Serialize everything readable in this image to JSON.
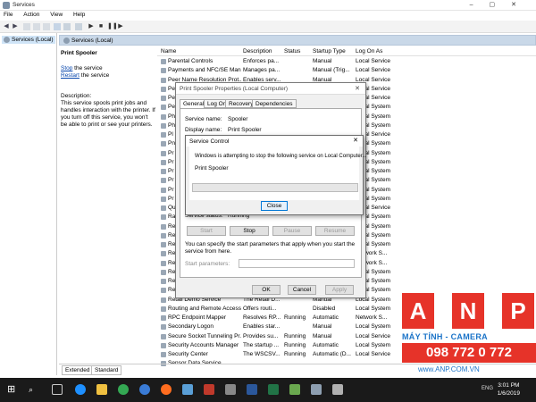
{
  "window": {
    "title": "Services"
  },
  "menu": [
    "File",
    "Action",
    "View",
    "Help"
  ],
  "tree": {
    "root": "Services (Local)"
  },
  "header": {
    "title": "Services (Local)"
  },
  "detail": {
    "service_name": "Print Spooler",
    "stop_link": "Stop",
    "stop_rest": " the service",
    "restart_link": "Restart",
    "restart_rest": " the service",
    "desc_label": "Description:",
    "desc_text": "This service spools print jobs and handles interaction with the printer. If you turn off this service, you won't be able to print or see your printers."
  },
  "columns": {
    "name": "Name",
    "description": "Description",
    "status": "Status",
    "startup": "Startup Type",
    "logon": "Log On As"
  },
  "rows": [
    {
      "name": "Parental Controls",
      "description": "Enforces pa...",
      "status": "",
      "startup": "Manual",
      "logon": "Local Service"
    },
    {
      "name": "Payments and NFC/SE Mana...",
      "description": "Manages pa...",
      "status": "",
      "startup": "Manual (Trig...",
      "logon": "Local Service"
    },
    {
      "name": "Peer Name Resolution Prot...",
      "description": "Enables serv...",
      "status": "",
      "startup": "Manual",
      "logon": "Local Service"
    },
    {
      "name": "Pe",
      "description": "",
      "status": "",
      "startup": "",
      "logon": "Local Service"
    },
    {
      "name": "Pe",
      "description": "",
      "status": "",
      "startup": "",
      "logon": "Local Service"
    },
    {
      "name": "Pe",
      "description": "",
      "status": "",
      "startup": "",
      "logon": "Local System"
    },
    {
      "name": "Ph",
      "description": "",
      "status": "",
      "startup": "",
      "logon": "Local System"
    },
    {
      "name": "Ph",
      "description": "",
      "status": "",
      "startup": "",
      "logon": "Local System"
    },
    {
      "name": "Pl",
      "description": "",
      "status": "",
      "startup": "",
      "logon": "Local Service"
    },
    {
      "name": "Pn",
      "description": "",
      "status": "",
      "startup": "",
      "logon": "Local System"
    },
    {
      "name": "Pr",
      "description": "",
      "status": "",
      "startup": "",
      "logon": "Local System"
    },
    {
      "name": "Pr",
      "description": "",
      "status": "",
      "startup": "",
      "logon": "Local System"
    },
    {
      "name": "Pr",
      "description": "",
      "status": "",
      "startup": "",
      "logon": "Local System"
    },
    {
      "name": "Pr",
      "description": "",
      "status": "",
      "startup": "",
      "logon": "Local System"
    },
    {
      "name": "Pr",
      "description": "",
      "status": "",
      "startup": "",
      "logon": "Local System"
    },
    {
      "name": "Pr",
      "description": "",
      "status": "",
      "startup": "",
      "logon": "Local System"
    },
    {
      "name": "Qu",
      "description": "",
      "status": "",
      "startup": "",
      "logon": "Local Service"
    },
    {
      "name": "Ra",
      "description": "",
      "status": "",
      "startup": "",
      "logon": "Local System"
    },
    {
      "name": "Re",
      "description": "",
      "status": "",
      "startup": "",
      "logon": "Local System"
    },
    {
      "name": "Re",
      "description": "",
      "status": "",
      "startup": "",
      "logon": "Local System"
    },
    {
      "name": "Re",
      "description": "",
      "status": "",
      "startup": "",
      "logon": "Local System"
    },
    {
      "name": "Re",
      "description": "",
      "status": "",
      "startup": "",
      "logon": "Network S..."
    },
    {
      "name": "Re",
      "description": "",
      "status": "",
      "startup": "",
      "logon": "Network S..."
    },
    {
      "name": "Re",
      "description": "",
      "status": "",
      "startup": "",
      "logon": "Local System"
    },
    {
      "name": "Re",
      "description": "",
      "status": "",
      "startup": "",
      "logon": "Local System"
    },
    {
      "name": "Re",
      "description": "",
      "status": "",
      "startup": "",
      "logon": "Local System"
    },
    {
      "name": "Retail Demo Service",
      "description": "The Retail D...",
      "status": "",
      "startup": "Manual",
      "logon": "Local System"
    },
    {
      "name": "Routing and Remote Access",
      "description": "Offers routi...",
      "status": "",
      "startup": "Disabled",
      "logon": "Local System"
    },
    {
      "name": "RPC Endpoint Mapper",
      "description": "Resolves RP...",
      "status": "Running",
      "startup": "Automatic",
      "logon": "Network S..."
    },
    {
      "name": "Secondary Logon",
      "description": "Enables star...",
      "status": "",
      "startup": "Manual",
      "logon": "Local System"
    },
    {
      "name": "Secure Socket Tunneling Pr...",
      "description": "Provides su...",
      "status": "Running",
      "startup": "Manual",
      "logon": "Local Service"
    },
    {
      "name": "Security Accounts Manager",
      "description": "The startup ...",
      "status": "Running",
      "startup": "Automatic",
      "logon": "Local System"
    },
    {
      "name": "Security Center",
      "description": "The WSCSV...",
      "status": "Running",
      "startup": "Automatic (D...",
      "logon": "Local Service"
    },
    {
      "name": "Sensor Data Service",
      "description": "",
      "status": "",
      "startup": "",
      "logon": ""
    }
  ],
  "bottom_tabs": [
    "Extended",
    "Standard"
  ],
  "props": {
    "title": "Print Spooler Properties (Local Computer)",
    "tabs": [
      "General",
      "Log On",
      "Recovery",
      "Dependencies"
    ],
    "service_name_label": "Service name:",
    "service_name_value": "Spooler",
    "display_name_label": "Display name:",
    "display_name_value": "Print Spooler",
    "status_label": "Service status:",
    "status_value": "Running",
    "start_btn": "Start",
    "stop_btn": "Stop",
    "pause_btn": "Pause",
    "resume_btn": "Resume",
    "hint": "You can specify the start parameters that apply when you start the service from here.",
    "params_label": "Start parameters:",
    "ok": "OK",
    "cancel": "Cancel",
    "apply": "Apply"
  },
  "service_control": {
    "title": "Service Control",
    "message": "Windows is attempting to stop the following service on Local Computer...",
    "service": "Print Spooler",
    "close": "Close"
  },
  "watermark": {
    "letters": [
      "A",
      "N",
      "P"
    ],
    "line1": "MÁY TÍNH - CAMERA",
    "phone": "098 772 0 772",
    "site": "www.ANP.COM.VN"
  },
  "taskbar": {
    "lang": "ENG",
    "time": "3:01 PM",
    "date": "1/6/2019"
  }
}
